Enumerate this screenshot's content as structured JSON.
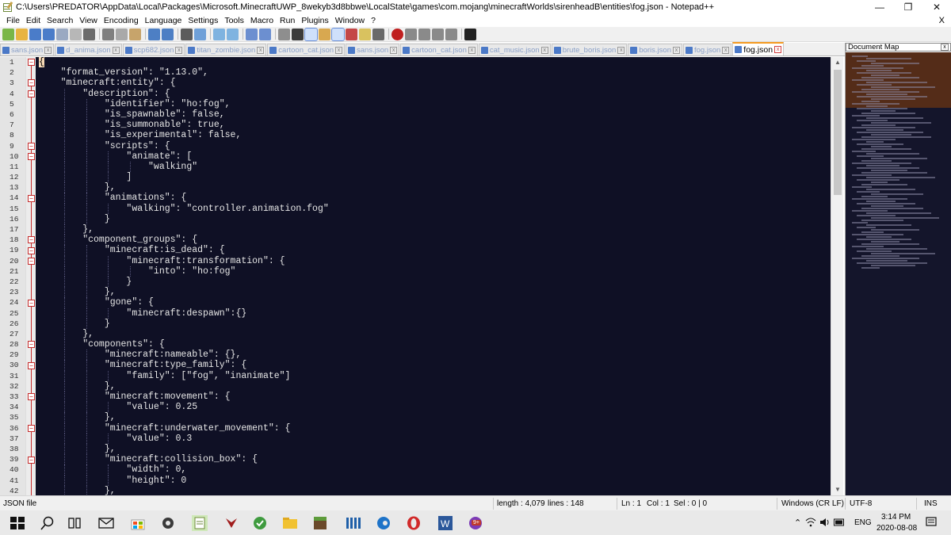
{
  "window": {
    "title": "C:\\Users\\PREDATOR\\AppData\\Local\\Packages\\Microsoft.MinecraftUWP_8wekyb3d8bbwe\\LocalState\\games\\com.mojang\\minecraftWorlds\\sirenheadB\\entities\\fog.json - Notepad++",
    "minimize": "—",
    "maximize": "❐",
    "close": "✕"
  },
  "menu": {
    "items": [
      "File",
      "Edit",
      "Search",
      "View",
      "Encoding",
      "Language",
      "Settings",
      "Tools",
      "Macro",
      "Run",
      "Plugins",
      "Window",
      "?"
    ],
    "close_doc": "X"
  },
  "tabs": [
    {
      "label": "sans.json",
      "active": false
    },
    {
      "label": "d_anima.json",
      "active": false
    },
    {
      "label": "scp682.json",
      "active": false
    },
    {
      "label": "titan_zombie.json",
      "active": false
    },
    {
      "label": "cartoon_cat.json",
      "active": false
    },
    {
      "label": "sans.json",
      "active": false
    },
    {
      "label": "cartoon_cat.json",
      "active": false
    },
    {
      "label": "cat_music.json",
      "active": false
    },
    {
      "label": "brute_boris.json",
      "active": false
    },
    {
      "label": "boris.json",
      "active": false
    },
    {
      "label": "fog.json",
      "active": false
    },
    {
      "label": "fog.json",
      "active": true
    }
  ],
  "document_map": {
    "title": "Document Map",
    "close": "x"
  },
  "code_lines": [
    "{",
    "    \"format_version\": \"1.13.0\",",
    "    \"minecraft:entity\": {",
    "        \"description\": {",
    "            \"identifier\": \"ho:fog\",",
    "            \"is_spawnable\": false,",
    "            \"is_summonable\": true,",
    "            \"is_experimental\": false,",
    "            \"scripts\": {",
    "                \"animate\": [",
    "                    \"walking\"",
    "                ]",
    "            },",
    "            \"animations\": {",
    "                \"walking\": \"controller.animation.fog\"",
    "            }",
    "        },",
    "        \"component_groups\": {",
    "            \"minecraft:is_dead\": {",
    "                \"minecraft:transformation\": {",
    "                    \"into\": \"ho:fog\"",
    "                }",
    "            },",
    "            \"gone\": {",
    "                \"minecraft:despawn\":{}",
    "            }",
    "        },",
    "        \"components\": {",
    "            \"minecraft:nameable\": {},",
    "            \"minecraft:type_family\": {",
    "                \"family\": [\"fog\", \"inanimate\"]",
    "            },",
    "            \"minecraft:movement\": {",
    "                \"value\": 0.25",
    "            },",
    "            \"minecraft:underwater_movement\": {",
    "                \"value\": 0.3",
    "            },",
    "            \"minecraft:collision_box\": {",
    "                \"width\": 0,",
    "                \"height\": 0",
    "            },"
  ],
  "fold_lines": [
    1,
    3,
    4,
    9,
    10,
    14,
    18,
    19,
    20,
    24,
    28,
    30,
    33,
    36,
    39
  ],
  "status": {
    "file_type": "JSON file",
    "length": "length : 4,079",
    "lines": "lines : 148",
    "ln": "Ln : 1",
    "col": "Col : 1",
    "sel": "Sel : 0 | 0",
    "eol": "Windows (CR LF)",
    "encoding": "UTF-8",
    "mode": "INS"
  },
  "taskbar": {
    "language": "ENG",
    "time": "3:14 PM",
    "date": "2020-08-08",
    "badge": "9+"
  }
}
